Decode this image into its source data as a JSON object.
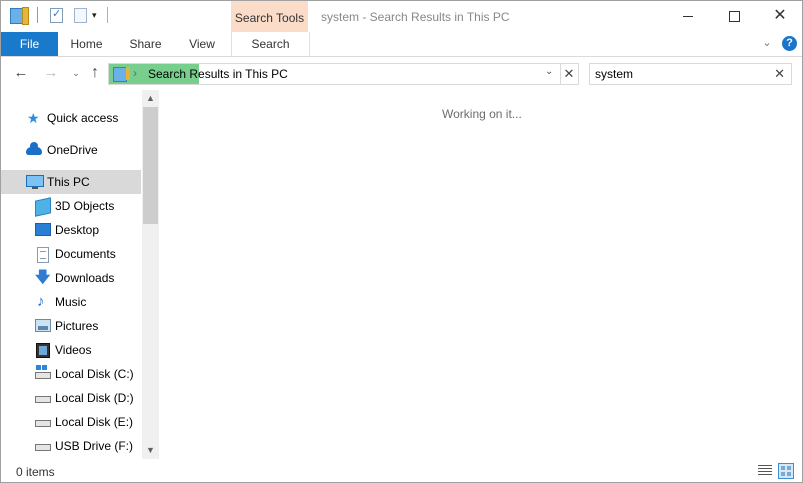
{
  "window": {
    "title": "system - Search Results in This PC",
    "controls": {
      "minimize": "minimize",
      "maximize": "maximize",
      "close": "✕"
    }
  },
  "quick_access_toolbar": {
    "icons": [
      "folder-icon",
      "properties-icon",
      "new-folder-icon"
    ],
    "dropdown": "▾"
  },
  "ribbon": {
    "context_header": "Search Tools",
    "tabs": [
      "File",
      "Home",
      "Share",
      "View",
      "Search"
    ],
    "active_context_tab": "Search",
    "collapse_chevron": "⌄",
    "help": "?",
    "colors": {
      "file_tab": "#1979ca",
      "context_header": "#fadcc8"
    }
  },
  "navigation": {
    "back": "←",
    "forward": "→",
    "recent": "⌄",
    "up": "↑"
  },
  "address_bar": {
    "separator": "›",
    "text": "Search Results in This PC",
    "dropdown": "⌄",
    "stop": "✕",
    "progress_fraction": 0.2,
    "progress_color": "#78cf8d"
  },
  "search": {
    "value": "system",
    "clear": "✕"
  },
  "nav_pane": {
    "items": [
      {
        "label": "Quick access",
        "icon": "star-icon"
      },
      {
        "label": "OneDrive",
        "icon": "cloud-icon"
      },
      {
        "label": "This PC",
        "icon": "computer-icon",
        "selected": true
      },
      {
        "label": "3D Objects",
        "icon": "cube-icon"
      },
      {
        "label": "Desktop",
        "icon": "desktop-icon"
      },
      {
        "label": "Documents",
        "icon": "documents-icon"
      },
      {
        "label": "Downloads",
        "icon": "download-icon"
      },
      {
        "label": "Music",
        "icon": "music-icon"
      },
      {
        "label": "Pictures",
        "icon": "pictures-icon"
      },
      {
        "label": "Videos",
        "icon": "videos-icon"
      },
      {
        "label": "Local Disk (C:)",
        "icon": "system-drive-icon"
      },
      {
        "label": "Local Disk (D:)",
        "icon": "drive-icon"
      },
      {
        "label": "Local Disk (E:)",
        "icon": "drive-icon"
      },
      {
        "label": "USB Drive (F:)",
        "icon": "usb-drive-icon"
      }
    ],
    "scroll_up": "▲",
    "scroll_down": "▼"
  },
  "content": {
    "message": "Working on it..."
  },
  "status_bar": {
    "item_count": "0 items",
    "view_buttons": [
      "details-view-icon",
      "large-icons-view-icon"
    ]
  }
}
